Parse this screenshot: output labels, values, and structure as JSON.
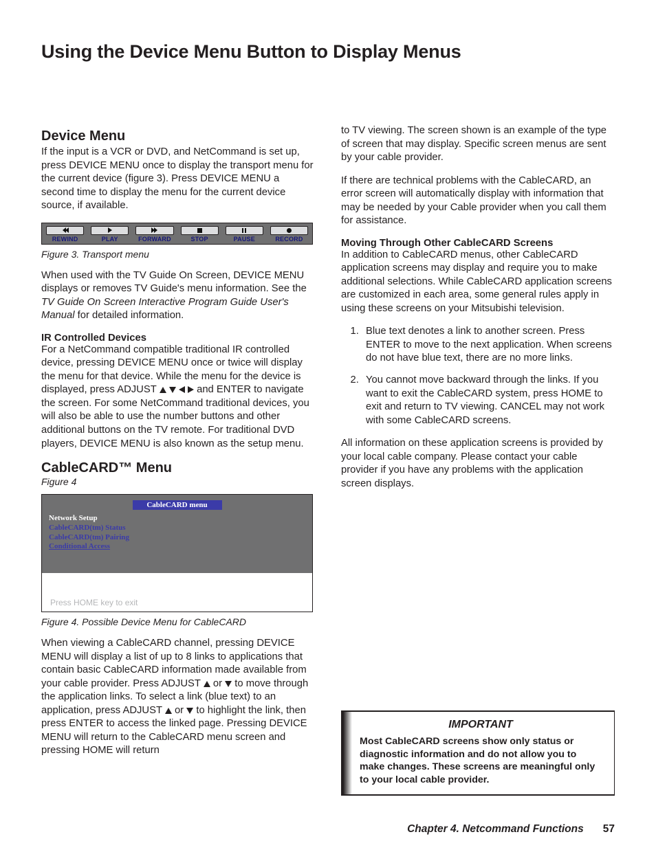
{
  "page_title": "Using the Device Menu Button to Display Menus",
  "left": {
    "device_menu_heading": "Device Menu",
    "device_menu_p1": "If the input is a VCR or DVD, and NetCommand is set up, press DEVICE MENU once to display the transport menu for the current device (figure 3).  Press DEVICE MENU a second time to display the menu for the current device source, if available.",
    "transport_buttons": [
      "REWIND",
      "PLAY",
      "FORWARD",
      "STOP",
      "PAUSE",
      "RECORD"
    ],
    "fig3_caption": "Figure 3. Transport menu",
    "device_menu_p2a": "When used with the TV Guide On Screen, DEVICE MENU displays or removes TV Guide's menu information.  See the ",
    "device_menu_p2_italic": "TV Guide On Screen Interactive Program Guide User's Manual",
    "device_menu_p2b": " for detailed information.",
    "ir_heading": "IR Controlled Devices",
    "ir_p_pre": "For a NetCommand compatible traditional IR controlled device, pressing DEVICE MENU once or twice will display the menu for that device.  While the menu for the device is displayed, press ADJUST ",
    "ir_p_post": " and ENTER to navigate the screen. For some NetCommand traditional devices, you will also be able to use the number buttons and other additional buttons on the TV remote.  For traditional DVD players, DEVICE MENU is also known as the setup menu.",
    "cablecard_heading": "CableCARD™ Menu",
    "fig4_label": "Figure 4",
    "ccard_title": "CableCARD menu",
    "ccard_items": [
      "Network Setup",
      "CableCARD(tm) Status",
      "CableCARD(tm) Pairing",
      "Conditional Access"
    ],
    "ccard_footer": "Press HOME key to exit",
    "fig4_caption": "Figure 4. Possible Device Menu for CableCARD",
    "cc_p1_a": "When viewing a CableCARD channel, pressing DEVICE MENU will display a list of up to 8 links to applications that contain basic CableCARD information made available from your cable provider.  Press ADJUST ",
    "cc_p1_b": " or ",
    "cc_p1_c": " to move through the application links.  To select a link (blue text) to an application, press ADJUST ",
    "cc_p1_d": " or ",
    "cc_p1_e": " to highlight the link, then press ENTER to access the linked page.  Pressing DEVICE MENU will return to the CableCARD menu screen and pressing HOME will return"
  },
  "right": {
    "cc_p1_cont": "to TV viewing.  The screen shown is an example of the type of screen that may display.  Specific screen menus are sent by your cable provider.",
    "cc_p2": "If there are technical problems with the CableCARD, an error screen will automatically display with information that may be needed by your Cable provider when you call them for assistance.",
    "moving_heading": "Moving Through Other CableCARD Screens",
    "moving_p": "In addition to CableCARD menus, other CableCARD application screens may display and require you to make additional selections.  While CableCARD application screens are customized in each area, some general rules apply in using these screens on your Mitsubishi television.",
    "list": [
      "Blue text denotes a link to another screen. Press ENTER to move to the next application. When screens do not have blue text, there are no more links.",
      "You cannot move backward through the links.  If you want to exit the CableCARD system, press HOME to exit and return to TV viewing.  CANCEL may not work with some CableCARD screens."
    ],
    "closing_p": "All information on these application screens is provided by your local cable company.  Please contact your cable provider if you have any problems with the application screen displays.",
    "important_heading": "IMPORTANT",
    "important_body": "Most CableCARD screens show only status or diagnostic information and do not allow you to make changes.  These screens are meaningful only to your local cable provider."
  },
  "footer": {
    "chapter": "Chapter 4. Netcommand Functions",
    "page": "57"
  }
}
